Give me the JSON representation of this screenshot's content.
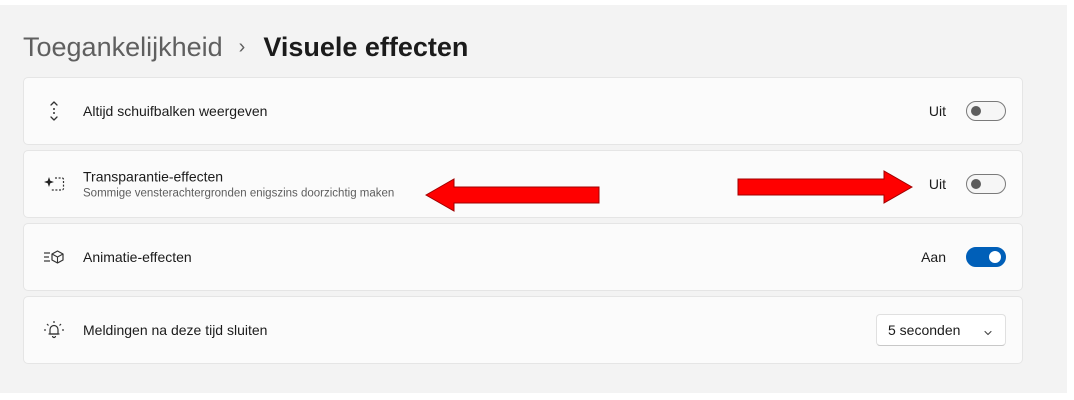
{
  "breadcrumb": {
    "parent": "Toegankelijkheid",
    "separator": "›",
    "current": "Visuele effecten"
  },
  "settings": [
    {
      "icon": "scrollbar-icon",
      "title": "Altijd schuifbalken weergeven",
      "control": "toggle",
      "state_label": "Uit",
      "on": false
    },
    {
      "icon": "transparency-icon",
      "title": "Transparantie-effecten",
      "description": "Sommige vensterachtergronden enigszins doorzichtig maken",
      "control": "toggle",
      "state_label": "Uit",
      "on": false
    },
    {
      "icon": "animation-icon",
      "title": "Animatie-effecten",
      "control": "toggle",
      "state_label": "Aan",
      "on": true
    },
    {
      "icon": "notification-bell-icon",
      "title": "Meldingen na deze tijd sluiten",
      "control": "dropdown",
      "selected": "5 seconden"
    }
  ],
  "annotations": {
    "arrow_color": "#ff0000",
    "arrows": [
      "left-pointing-arrow",
      "right-pointing-arrow"
    ]
  },
  "colors": {
    "accent": "#005fb8",
    "background": "#f3f3f3",
    "card": "#fbfbfb"
  }
}
